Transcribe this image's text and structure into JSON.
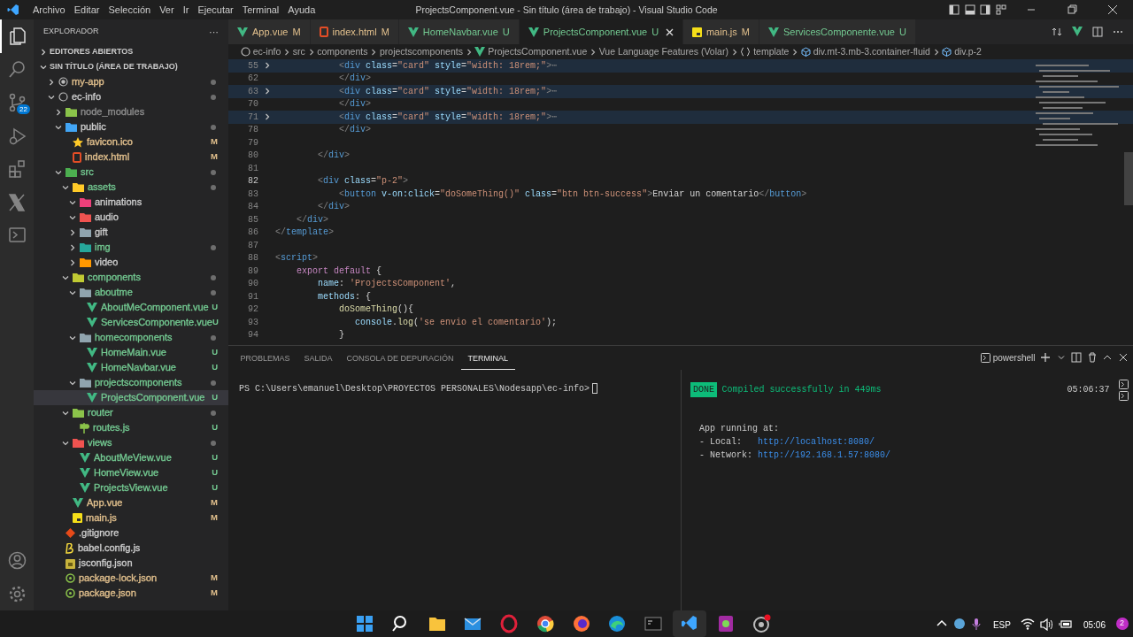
{
  "titlebar": {
    "menu": [
      "Archivo",
      "Editar",
      "Selección",
      "Ver",
      "Ir",
      "Ejecutar",
      "Terminal",
      "Ayuda"
    ],
    "title": "ProjectsComponent.vue - Sin título (área de trabajo) - Visual Studio Code"
  },
  "activity_bar": [
    {
      "kind": "files",
      "selected": true
    },
    {
      "kind": "search",
      "selected": false
    },
    {
      "kind": "scm",
      "selected": false,
      "badge": "22"
    },
    {
      "kind": "run",
      "selected": false
    },
    {
      "kind": "extensions",
      "selected": false
    },
    {
      "kind": "x",
      "selected": false
    },
    {
      "kind": "terminal",
      "selected": false
    }
  ],
  "sidebar": {
    "title": "EXPLORADOR",
    "more": "···",
    "open_editors": {
      "title": "EDITORES ABIERTOS",
      "expanded": false
    },
    "workspace": {
      "title": "SIN TÍTULO (ÁREA DE TRABAJO)",
      "expanded": true
    },
    "items": [
      {
        "label": "my-app",
        "kind": "rootdot",
        "expanded": false,
        "color": "#e2c08d",
        "dot": true,
        "selected": false
      },
      {
        "label": "ec-info",
        "kind": "root",
        "expanded": true,
        "color": "#cccccc",
        "dot": true,
        "selected": false,
        "children": [
          {
            "label": "node_modules",
            "kind": "node",
            "expanded": false,
            "color": "#8c8c8c",
            "selected": false
          },
          {
            "label": "public",
            "kind": "public",
            "expanded": true,
            "color": "#cccccc",
            "dot": true,
            "selected": false,
            "children": [
              {
                "label": "favicon.ico",
                "kind": "star",
                "color": "#e2c08d",
                "badge": "M",
                "selected": false
              },
              {
                "label": "index.html",
                "kind": "html",
                "color": "#e2c08d",
                "badge": "M",
                "selected": false
              }
            ]
          },
          {
            "label": "src",
            "kind": "src",
            "expanded": true,
            "color": "#73c991",
            "dot": true,
            "selected": false,
            "children": [
              {
                "label": "assets",
                "kind": "assets",
                "expanded": true,
                "color": "#73c991",
                "dot": true,
                "selected": false,
                "children": [
                  {
                    "label": "animations",
                    "kind": "animations",
                    "expanded": true,
                    "color": "#cccccc",
                    "selected": false
                  },
                  {
                    "label": "audio",
                    "kind": "audio",
                    "expanded": true,
                    "color": "#cccccc",
                    "selected": false
                  },
                  {
                    "label": "gift",
                    "kind": "gift",
                    "expanded": false,
                    "color": "#cccccc",
                    "selected": false
                  },
                  {
                    "label": "img",
                    "kind": "img",
                    "expanded": false,
                    "color": "#73c991",
                    "dot": true,
                    "selected": false
                  },
                  {
                    "label": "video",
                    "kind": "video",
                    "expanded": false,
                    "color": "#cccccc",
                    "selected": false
                  }
                ]
              },
              {
                "label": "components",
                "kind": "components",
                "expanded": true,
                "color": "#73c991",
                "dot": true,
                "selected": false,
                "children": [
                  {
                    "label": "aboutme",
                    "kind": "plain",
                    "expanded": true,
                    "color": "#73c991",
                    "dot": true,
                    "selected": false,
                    "children": [
                      {
                        "label": "AboutMeComponent.vue",
                        "kind": "vue",
                        "color": "#73c991",
                        "badge": "U",
                        "selected": false
                      },
                      {
                        "label": "ServicesComponente.vue",
                        "kind": "vue",
                        "color": "#73c991",
                        "badge": "U",
                        "selected": false
                      }
                    ]
                  },
                  {
                    "label": "homecomponents",
                    "kind": "plain",
                    "expanded": true,
                    "color": "#73c991",
                    "dot": true,
                    "selected": false,
                    "children": [
                      {
                        "label": "HomeMain.vue",
                        "kind": "vue",
                        "color": "#73c991",
                        "badge": "U",
                        "selected": false
                      },
                      {
                        "label": "HomeNavbar.vue",
                        "kind": "vue",
                        "color": "#73c991",
                        "badge": "U",
                        "selected": false
                      }
                    ]
                  },
                  {
                    "label": "projectscomponents",
                    "kind": "plain",
                    "expanded": true,
                    "color": "#73c991",
                    "dot": true,
                    "selected": false,
                    "children": [
                      {
                        "label": "ProjectsComponent.vue",
                        "kind": "vue",
                        "color": "#73c991",
                        "badge": "U",
                        "selected": true
                      }
                    ]
                  }
                ]
              },
              {
                "label": "router",
                "kind": "router",
                "expanded": true,
                "color": "#73c991",
                "dot": true,
                "selected": false,
                "children": [
                  {
                    "label": "routes.js",
                    "kind": "routes",
                    "color": "#73c991",
                    "badge": "U",
                    "selected": false
                  }
                ]
              },
              {
                "label": "views",
                "kind": "views",
                "expanded": true,
                "color": "#73c991",
                "dot": true,
                "selected": false,
                "children": [
                  {
                    "label": "AboutMeView.vue",
                    "kind": "vue",
                    "color": "#73c991",
                    "badge": "U",
                    "selected": false
                  },
                  {
                    "label": "HomeView.vue",
                    "kind": "vue",
                    "color": "#73c991",
                    "badge": "U",
                    "selected": false
                  },
                  {
                    "label": "ProjectsView.vue",
                    "kind": "vue",
                    "color": "#73c991",
                    "badge": "U",
                    "selected": false
                  }
                ]
              },
              {
                "label": "App.vue",
                "kind": "vue",
                "color": "#e2c08d",
                "badge": "M",
                "selected": false
              },
              {
                "label": "main.js",
                "kind": "js",
                "color": "#e2c08d",
                "badge": "M",
                "selected": false
              }
            ]
          },
          {
            "label": ".gitignore",
            "kind": "git",
            "color": "#cccccc",
            "selected": false
          },
          {
            "label": "babel.config.js",
            "kind": "babel",
            "color": "#cccccc",
            "selected": false
          },
          {
            "label": "jsconfig.json",
            "kind": "jsconfig",
            "color": "#cccccc",
            "selected": false
          },
          {
            "label": "package-lock.json",
            "kind": "npm",
            "color": "#e2c08d",
            "badge": "M",
            "selected": false
          },
          {
            "label": "package.json",
            "kind": "npm",
            "color": "#e2c08d",
            "badge": "M",
            "selected": false
          }
        ]
      }
    ]
  },
  "tabs": [
    {
      "label": "App.vue",
      "kind": "vue",
      "color": "#e2c08d",
      "badge": "M",
      "selected": false
    },
    {
      "label": "index.html",
      "kind": "html",
      "color": "#e2c08d",
      "badge": "M",
      "selected": false
    },
    {
      "label": "HomeNavbar.vue",
      "kind": "vue",
      "color": "#73c991",
      "badge": "U",
      "selected": false
    },
    {
      "label": "ProjectsComponent.vue",
      "kind": "vue",
      "color": "#73c991",
      "badge": "U",
      "selected": true
    },
    {
      "label": "main.js",
      "kind": "js",
      "color": "#e2c08d",
      "badge": "M",
      "selected": false
    },
    {
      "label": "ServicesComponente.vue",
      "kind": "vue",
      "color": "#73c991",
      "badge": "U",
      "selected": false
    }
  ],
  "breadcrumbs": [
    {
      "text": "ec-info",
      "kind": "root"
    },
    {
      "text": "src"
    },
    {
      "text": "components"
    },
    {
      "text": "projectscomponents"
    },
    {
      "text": "ProjectsComponent.vue",
      "kind": "vue"
    },
    {
      "text": "Vue Language Features (Volar)"
    },
    {
      "text": "template",
      "kind": "braces"
    },
    {
      "text": "div.mt-3.mb-3.container-fluid",
      "kind": "element"
    },
    {
      "text": "div.p-2",
      "kind": "element"
    }
  ],
  "code": [
    {
      "number": "55",
      "folded": true,
      "current": false,
      "tokens": [
        {
          "kind": "punct",
          "text": "            <"
        },
        {
          "kind": "tag",
          "text": "div"
        },
        {
          "kind": "attr",
          "text": " class"
        },
        {
          "kind": "text",
          "text": "="
        },
        {
          "kind": "string",
          "text": "\"card\""
        },
        {
          "kind": "attr",
          "text": " style"
        },
        {
          "kind": "text",
          "text": "="
        },
        {
          "kind": "string",
          "text": "\"width: 18rem;\""
        },
        {
          "kind": "punct",
          "text": ">"
        },
        {
          "kind": "fold",
          "text": "⋯"
        }
      ]
    },
    {
      "number": "62",
      "folded": false,
      "current": false,
      "tokens": [
        {
          "kind": "punct",
          "text": "            </"
        },
        {
          "kind": "tag",
          "text": "div"
        },
        {
          "kind": "punct",
          "text": ">"
        }
      ]
    },
    {
      "number": "63",
      "folded": true,
      "current": false,
      "tokens": [
        {
          "kind": "punct",
          "text": "            <"
        },
        {
          "kind": "tag",
          "text": "div"
        },
        {
          "kind": "attr",
          "text": " class"
        },
        {
          "kind": "text",
          "text": "="
        },
        {
          "kind": "string",
          "text": "\"card\""
        },
        {
          "kind": "attr",
          "text": " style"
        },
        {
          "kind": "text",
          "text": "="
        },
        {
          "kind": "string",
          "text": "\"width: 18rem;\""
        },
        {
          "kind": "punct",
          "text": ">"
        },
        {
          "kind": "fold",
          "text": "⋯"
        }
      ]
    },
    {
      "number": "70",
      "folded": false,
      "current": false,
      "tokens": [
        {
          "kind": "punct",
          "text": "            </"
        },
        {
          "kind": "tag",
          "text": "div"
        },
        {
          "kind": "punct",
          "text": ">"
        }
      ]
    },
    {
      "number": "71",
      "folded": true,
      "current": false,
      "tokens": [
        {
          "kind": "punct",
          "text": "            <"
        },
        {
          "kind": "tag",
          "text": "div"
        },
        {
          "kind": "attr",
          "text": " class"
        },
        {
          "kind": "text",
          "text": "="
        },
        {
          "kind": "string",
          "text": "\"card\""
        },
        {
          "kind": "attr",
          "text": " style"
        },
        {
          "kind": "text",
          "text": "="
        },
        {
          "kind": "string",
          "text": "\"width: 18rem;\""
        },
        {
          "kind": "punct",
          "text": ">"
        },
        {
          "kind": "fold",
          "text": "⋯"
        }
      ]
    },
    {
      "number": "78",
      "folded": false,
      "current": false,
      "tokens": [
        {
          "kind": "punct",
          "text": "            </"
        },
        {
          "kind": "tag",
          "text": "div"
        },
        {
          "kind": "punct",
          "text": ">"
        }
      ]
    },
    {
      "number": "79",
      "folded": false,
      "current": false
    },
    {
      "number": "80",
      "folded": false,
      "current": false,
      "tokens": [
        {
          "kind": "punct",
          "text": "        </"
        },
        {
          "kind": "tag",
          "text": "div"
        },
        {
          "kind": "punct",
          "text": ">"
        }
      ]
    },
    {
      "number": "81",
      "folded": false,
      "current": false
    },
    {
      "number": "82",
      "folded": false,
      "current": true,
      "tokens": [
        {
          "kind": "punct",
          "text": "        <"
        },
        {
          "kind": "tag",
          "text": "div"
        },
        {
          "kind": "attr",
          "text": " class"
        },
        {
          "kind": "text",
          "text": "="
        },
        {
          "kind": "string",
          "text": "\"p-2\""
        },
        {
          "kind": "punct",
          "text": ">"
        }
      ]
    },
    {
      "number": "83",
      "folded": false,
      "current": false,
      "tokens": [
        {
          "kind": "punct",
          "text": "            <"
        },
        {
          "kind": "tag",
          "text": "button"
        },
        {
          "kind": "attr",
          "text": " v-on:click"
        },
        {
          "kind": "text",
          "text": "="
        },
        {
          "kind": "string",
          "text": "\"doSomeThing()\""
        },
        {
          "kind": "attr",
          "text": " class"
        },
        {
          "kind": "text",
          "text": "="
        },
        {
          "kind": "string",
          "text": "\"btn btn-success\""
        },
        {
          "kind": "punct",
          "text": ">"
        },
        {
          "kind": "text",
          "text": "Enviar un comentario"
        },
        {
          "kind": "punct",
          "text": "</"
        },
        {
          "kind": "tag",
          "text": "button"
        },
        {
          "kind": "punct",
          "text": ">"
        }
      ]
    },
    {
      "number": "84",
      "folded": false,
      "current": false,
      "tokens": [
        {
          "kind": "punct",
          "text": "        </"
        },
        {
          "kind": "tag",
          "text": "div"
        },
        {
          "kind": "punct",
          "text": ">"
        }
      ]
    },
    {
      "number": "85",
      "folded": false,
      "current": false,
      "tokens": [
        {
          "kind": "punct",
          "text": "    </"
        },
        {
          "kind": "tag",
          "text": "div"
        },
        {
          "kind": "punct",
          "text": ">"
        }
      ]
    },
    {
      "number": "86",
      "folded": false,
      "current": false,
      "tokens": [
        {
          "kind": "punct",
          "text": "</"
        },
        {
          "kind": "tag",
          "text": "template"
        },
        {
          "kind": "punct",
          "text": ">"
        }
      ]
    },
    {
      "number": "87",
      "folded": false,
      "current": false
    },
    {
      "number": "88",
      "folded": false,
      "current": false,
      "tokens": [
        {
          "kind": "punct",
          "text": "<"
        },
        {
          "kind": "tag",
          "text": "script"
        },
        {
          "kind": "punct",
          "text": ">"
        }
      ]
    },
    {
      "number": "89",
      "folded": false,
      "current": false,
      "tokens": [
        {
          "kind": "keyword",
          "text": "    export default"
        },
        {
          "kind": "text",
          "text": " {"
        }
      ]
    },
    {
      "number": "90",
      "folded": false,
      "current": false,
      "tokens": [
        {
          "kind": "property",
          "text": "        name"
        },
        {
          "kind": "text",
          "text": ": "
        },
        {
          "kind": "string",
          "text": "'ProjectsComponent'"
        },
        {
          "kind": "text",
          "text": ","
        }
      ]
    },
    {
      "number": "91",
      "folded": false,
      "current": false,
      "tokens": [
        {
          "kind": "property",
          "text": "        methods"
        },
        {
          "kind": "text",
          "text": ": {"
        }
      ]
    },
    {
      "number": "92",
      "folded": false,
      "current": false,
      "tokens": [
        {
          "kind": "function",
          "text": "            doSomeThing"
        },
        {
          "kind": "text",
          "text": "(){"
        }
      ]
    },
    {
      "number": "93",
      "folded": false,
      "current": false,
      "tokens": [
        {
          "kind": "property",
          "text": "               console"
        },
        {
          "kind": "text",
          "text": "."
        },
        {
          "kind": "function",
          "text": "log"
        },
        {
          "kind": "text",
          "text": "("
        },
        {
          "kind": "string",
          "text": "'se envio el comentario'"
        },
        {
          "kind": "text",
          "text": ");"
        }
      ]
    },
    {
      "number": "94",
      "folded": false,
      "current": false,
      "tokens": [
        {
          "kind": "text",
          "text": "            }"
        }
      ]
    }
  ],
  "panel": {
    "tabs": [
      {
        "label": "PROBLEMAS",
        "selected": false
      },
      {
        "label": "SALIDA",
        "selected": false
      },
      {
        "label": "CONSOLA DE DEPURACIÓN",
        "selected": false
      },
      {
        "label": "TERMINAL",
        "selected": true
      }
    ],
    "shell": "powershell",
    "prompt": "PS C:\\Users\\emanuel\\Desktop\\PROYECTOS PERSONALES\\Nodesapp\\ec-info>",
    "output": {
      "badge": "DONE",
      "message": "Compiled successfully in 449ms",
      "time": "05:06:37",
      "heading": "App running at:",
      "urls": [
        {
          "label": "- Local:",
          "url": "http://localhost:8080/"
        },
        {
          "label": "- Network:",
          "url": "http://192.168.1.57:8080/"
        }
      ]
    }
  },
  "taskbar": {
    "apps": [
      {
        "kind": "start",
        "selected": false
      },
      {
        "kind": "search",
        "selected": false
      },
      {
        "kind": "folder",
        "selected": false
      },
      {
        "kind": "mail",
        "selected": false
      },
      {
        "kind": "opera",
        "selected": false
      },
      {
        "kind": "chrome",
        "selected": false
      },
      {
        "kind": "firefox",
        "selected": false
      },
      {
        "kind": "edge",
        "selected": false
      },
      {
        "kind": "console",
        "selected": false
      },
      {
        "kind": "vscode",
        "selected": true
      },
      {
        "kind": "app",
        "selected": false
      },
      {
        "kind": "obs",
        "selected": false
      }
    ],
    "language": "ESP",
    "clock": "05:06",
    "notifications": "2"
  }
}
